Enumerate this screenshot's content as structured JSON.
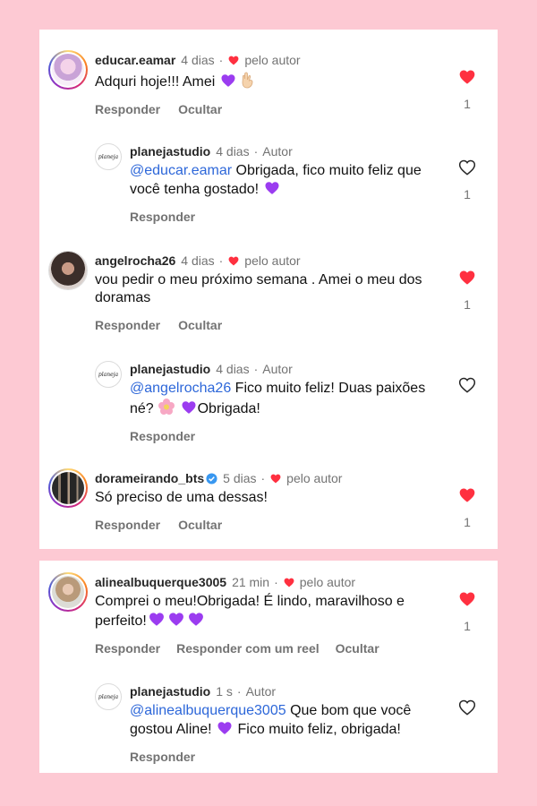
{
  "comments": [
    {
      "username": "educar.eamar",
      "time": "4 dias",
      "author_liked": "pelo autor",
      "text": "Adquri hoje!!! Amei",
      "emojis": [
        "purple-heart",
        "hand"
      ],
      "actions": [
        "Responder",
        "Ocultar"
      ],
      "like_count": "1",
      "liked": true,
      "reply": {
        "username": "planejastudio",
        "time": "4 dias",
        "role": "Autor",
        "mention": "@educar.eamar",
        "text": "Obrigada, fico muito feliz que você tenha gostado!",
        "action": "Responder",
        "like_count": "1",
        "liked": false
      }
    },
    {
      "username": "angelrocha26",
      "time": "4 dias",
      "author_liked": "pelo autor",
      "text": "vou pedir o meu próximo semana . Amei o meu dos doramas",
      "actions": [
        "Responder",
        "Ocultar"
      ],
      "like_count": "1",
      "liked": true,
      "reply": {
        "username": "planejastudio",
        "time": "4 dias",
        "role": "Autor",
        "mention": "@angelrocha26",
        "text_1": "Fico muito feliz! Duas paixões né?",
        "text_2": "Obrigada!",
        "action": "Responder",
        "liked": false
      }
    },
    {
      "username": "dorameirando_bts",
      "time": "5 dias",
      "author_liked": "pelo autor",
      "text": "Só preciso de uma dessas!",
      "actions": [
        "Responder",
        "Ocultar"
      ],
      "like_count": "1",
      "liked": true
    },
    {
      "username": "alinealbuquerque3005",
      "time": "21 min",
      "author_liked": "pelo autor",
      "text": "Comprei o meu!Obrigada! É lindo, maravilhoso e perfeito!",
      "actions": [
        "Responder",
        "Responder com um reel",
        "Ocultar"
      ],
      "like_count": "1",
      "liked": true,
      "reply": {
        "username": "planejastudio",
        "time": "1 s",
        "role": "Autor",
        "mention": "@alinealbuquerque3005",
        "text_1": "Que bom que você gostou Aline!",
        "text_2": "Fico muito feliz, obrigada!",
        "action": "Responder",
        "liked": false
      }
    }
  ],
  "brand_logo_text": "planeja",
  "colors": {
    "background": "#fdc9d3",
    "like_red": "#ff3040",
    "mention_blue": "#2d67d9",
    "purple_heart": "#9b3cf0"
  }
}
